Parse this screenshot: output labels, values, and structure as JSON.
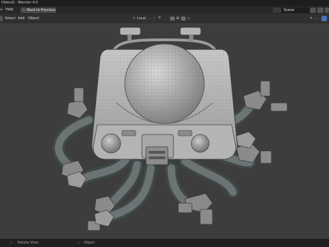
{
  "window": {
    "title": "f/blend] - Blender 4.0"
  },
  "topbar": {
    "help_label": "Help",
    "back_to_previous_label": "Back to Previous",
    "scene_value": "Scene",
    "scene_label": "Scene"
  },
  "header": {
    "select_label": "Select",
    "add_label": "Add",
    "object_label": "Object",
    "orientation_value": "Local"
  },
  "statusbar": {
    "left_hint": "Rotate View",
    "right_hint": "Object"
  },
  "icons": {
    "window_menu": "blender-menu-icon",
    "viewport_shading": "solid-sphere-icon",
    "gizmo": "axis-gizmo-icon"
  }
}
